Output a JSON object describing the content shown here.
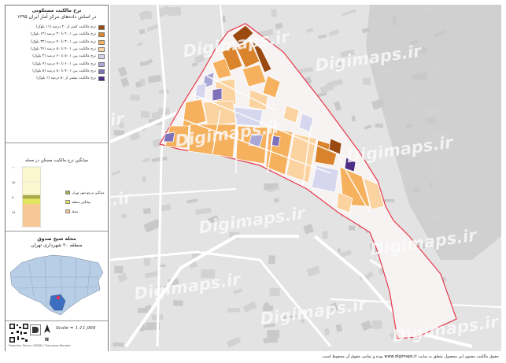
{
  "map": {
    "legend_title_line1": "نرخ مالکیت مستکونی",
    "legend_title_line2": "در اساس داده‌های مرکز آمار ایران ۱۳۹۵",
    "legend_items": [
      {
        "label": "نرخ مالکیت کمتر از ۲۰ درصد (۱۱ بلوک)",
        "color": "#9a4a10"
      },
      {
        "label": "نرخ مالکیت بین ۲۰.۱ تا ۳۰ درصد (۱۲ بلوک)",
        "color": "#d9832c"
      },
      {
        "label": "نرخ مالکیت بین ۳۰.۱ تا ۴۰ درصد (۳۲ بلوک)",
        "color": "#f5b15e"
      },
      {
        "label": "نرخ مالکیت بین ۴۰.۱ تا ۵۰ درصد (۲۶ بلوک)",
        "color": "#fad3a0"
      },
      {
        "label": "نرخ مالکیت بین ۵۰.۱ تا ۶۰ درصد (۳ بلوک)",
        "color": "#d6d6ee"
      },
      {
        "label": "نرخ مالکیت بین ۶۰.۱ تا ۷۰ درصد (۴ بلوک)",
        "color": "#a9a7d6"
      },
      {
        "label": "نرخ مالکیت بین ۷۰.۱ تا ۸۰ درصد (۸ بلوک)",
        "color": "#7d72ba"
      },
      {
        "label": "نرخ مالکیت بیشتر از ۸۰ درصد (۱ بلوک)",
        "color": "#4e2d86"
      }
    ],
    "chart_title": "میانگین نرخ مالکیت مسکن در محله",
    "chart_ticks": [
      "۱۰۰",
      "۷۵",
      "۵۰",
      "۲۵",
      "۰"
    ],
    "chart_keys": [
      {
        "label": "میانگین مرجع شهر تهران",
        "color": "#a8ab4a"
      },
      {
        "label": "میانگین منطقه",
        "color": "#e3e45e"
      },
      {
        "label": "محله",
        "color": "#f6c896"
      }
    ],
    "locator_title": "محله شیخ صدوق",
    "locator_subtitle": "منطقه ۲۰ شهرداری تهران",
    "scale_text": "Scale = 1:11,000",
    "north_label": "N",
    "projection_text": "Projection: Tehran / WGS84 / Transverse Mercator",
    "watermark_text": "Digimaps.ir",
    "copyright": "حقوق مالکیت معنوی این محصول متعلق به سایت www.digimaps.ir بوده و تمامی حقوق آن محفوظ است.",
    "colors": {
      "neighborhood_fill": "#f7f3f3",
      "neighborhood_outline": "#e8374a",
      "basemap": "#e0e0e0",
      "river": "#cbcbcb",
      "locator_city": "#b8cde6",
      "locator_highlight": "#3e6fbf"
    }
  },
  "chart_data": {
    "type": "bar",
    "categories": [
      "میانگین مرجع شهر تهران",
      "میانگین منطقه",
      "محله"
    ],
    "values": [
      53,
      47,
      38
    ],
    "ylim": [
      0,
      100
    ]
  }
}
